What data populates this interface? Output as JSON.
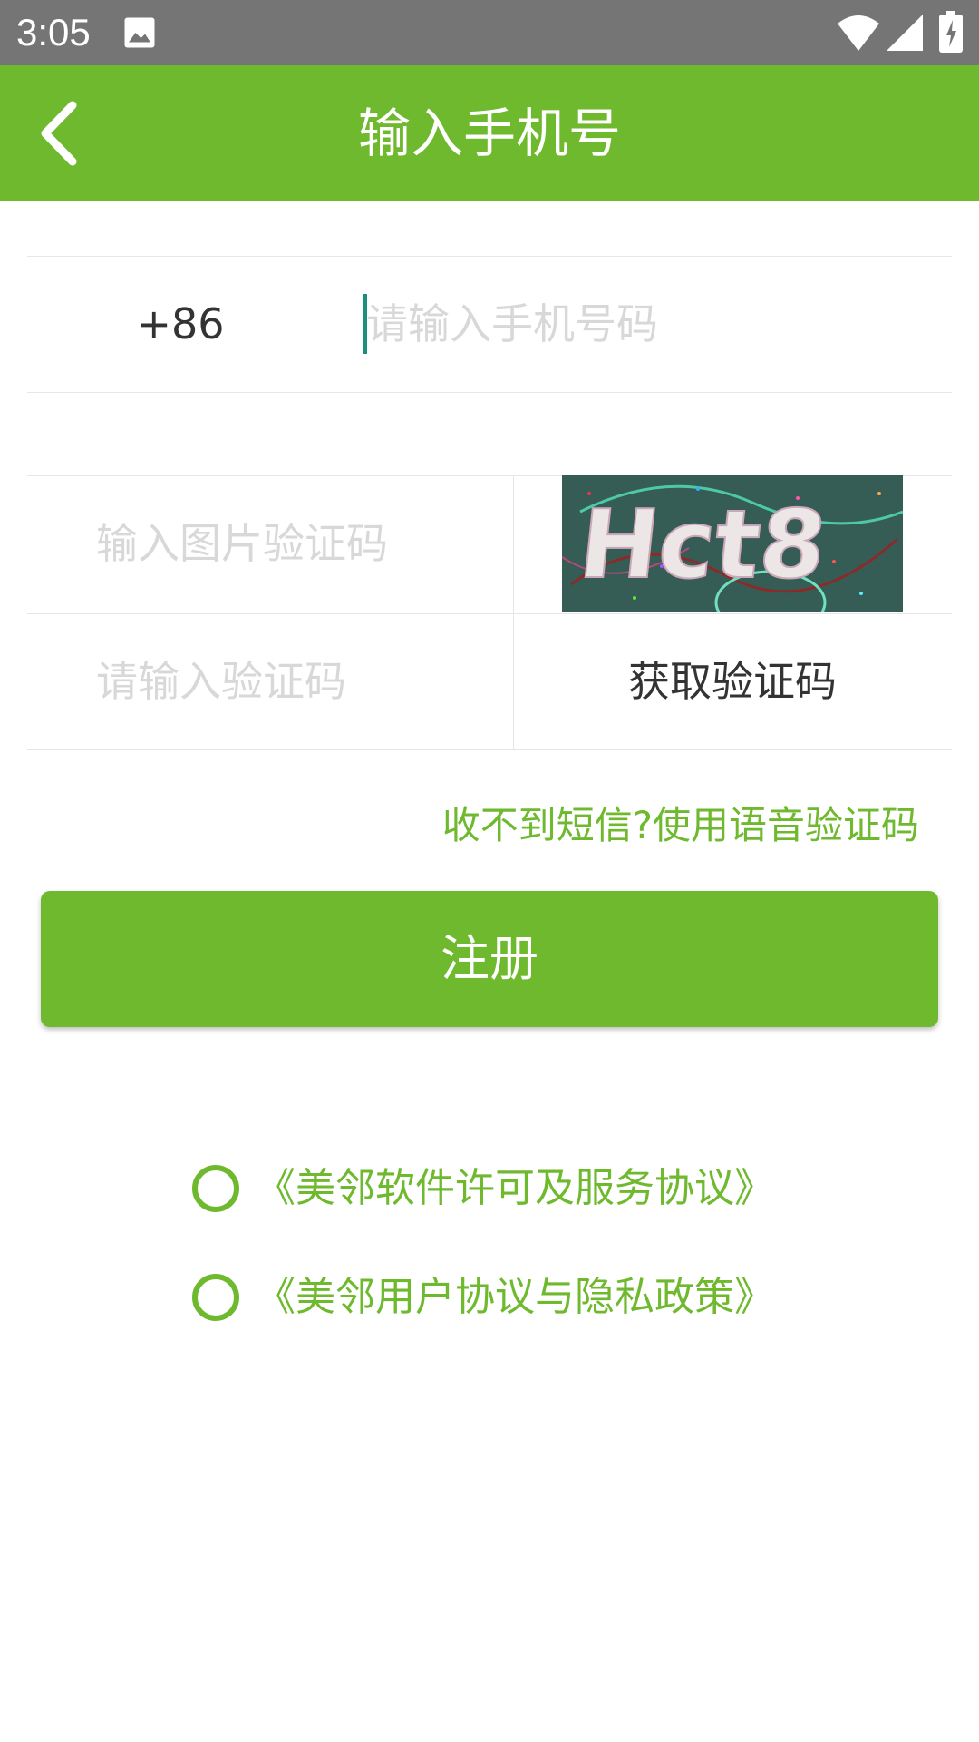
{
  "status_bar": {
    "time": "3:05",
    "icons": [
      "image-icon",
      "wifi-icon",
      "signal-icon",
      "battery-icon"
    ]
  },
  "app_bar": {
    "title": "输入手机号",
    "back_icon": "chevron-left-icon",
    "color": "#6fb92e"
  },
  "form": {
    "country_code": "+86",
    "phone_placeholder": "请输入手机号码",
    "phone_value": "",
    "captcha_placeholder": "输入图片验证码",
    "captcha_image_text": "Hct8",
    "sms_placeholder": "请输入验证码",
    "get_code_label": "获取验证码",
    "voice_code_link": "收不到短信?使用语音验证码"
  },
  "register_button": {
    "label": "注册"
  },
  "agreements": [
    {
      "label": "《美邻软件许可及服务协议》",
      "checked": false
    },
    {
      "label": "《美邻用户协议与隐私政策》",
      "checked": false
    }
  ],
  "colors": {
    "accent": "#6fb92e",
    "status_bar": "#757575",
    "cursor": "#1a8f80"
  }
}
